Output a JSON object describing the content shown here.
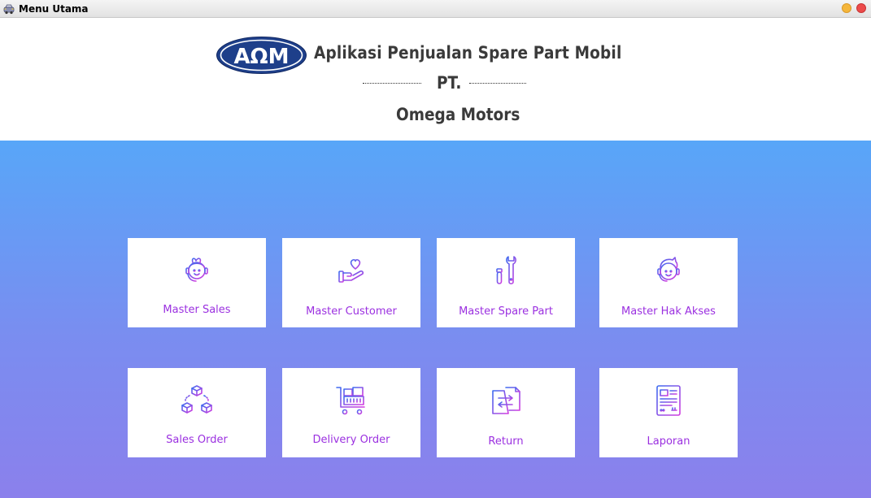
{
  "window": {
    "title": "Menu Utama",
    "icon": "car-icon"
  },
  "header": {
    "logo_text": "AΩM",
    "app_title": "Aplikasi Penjualan Spare Part Mobil",
    "company_prefix": "PT.",
    "company_name": "Omega Motors"
  },
  "colors": {
    "gradient_top": "#58a6f8",
    "gradient_bottom": "#8b80ec",
    "tile_label": "#9b30e0",
    "icon_gradient_start": "#3d6cf0",
    "icon_gradient_end": "#d23ce0",
    "logo_blue": "#1e3f8a"
  },
  "menu": {
    "items": [
      {
        "label": "Master Sales",
        "icon": "headset-girl-icon"
      },
      {
        "label": "Master Customer",
        "icon": "hand-heart-icon"
      },
      {
        "label": "Master Spare Part",
        "icon": "screwdriver-wrench-icon"
      },
      {
        "label": "Master Hak Akses",
        "icon": "support-agent-icon"
      },
      {
        "label": "Sales Order",
        "icon": "boxes-network-icon"
      },
      {
        "label": "Delivery Order",
        "icon": "cart-delivery-icon"
      },
      {
        "label": "Return",
        "icon": "document-exchange-icon"
      },
      {
        "label": "Laporan",
        "icon": "report-document-icon"
      }
    ]
  }
}
